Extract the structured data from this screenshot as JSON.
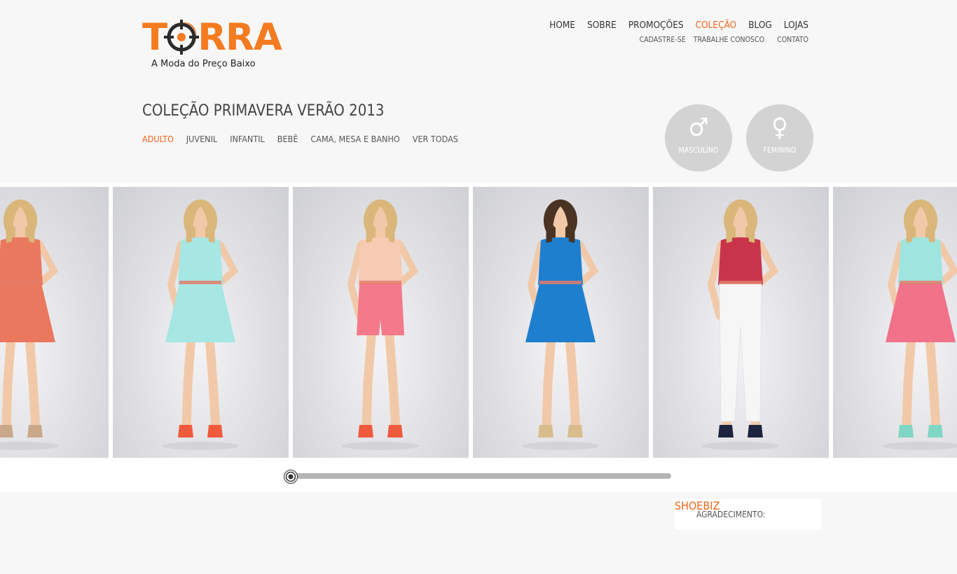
{
  "brand": {
    "logo_text": "TORRA",
    "tagline": "A Moda do Preço Baixo",
    "accent": "#f47b20"
  },
  "main_nav": {
    "items": [
      {
        "label": "HOME"
      },
      {
        "label": "SOBRE"
      },
      {
        "label": "PROMOÇÕES"
      },
      {
        "label": "COLEÇÃO",
        "active": true
      },
      {
        "label": "BLOG"
      },
      {
        "label": "LOJAS"
      }
    ]
  },
  "sub_nav": {
    "items": [
      {
        "label": "CADASTRE-SE"
      },
      {
        "label": "TRABALHE CONOSCO"
      },
      {
        "label": "CONTATO"
      }
    ]
  },
  "collection": {
    "title": "COLEÇÃO PRIMAVERA VERÃO 2013",
    "categories": [
      {
        "label": "ADULTO",
        "active": true
      },
      {
        "label": "JUVENIL"
      },
      {
        "label": "INFANTIL"
      },
      {
        "label": "BEBÊ"
      },
      {
        "label": "CAMA, MESA E BANHO"
      },
      {
        "label": "VER TODAS"
      }
    ]
  },
  "gender": {
    "male": {
      "symbol": "♂",
      "label": "MASCULINO"
    },
    "female": {
      "symbol": "♀",
      "label": "FEMININO"
    }
  },
  "gallery": {
    "photos": [
      {
        "icon": "model-floral-dress-photo",
        "top_color": "#e9785e",
        "bottom_color": "#e9785e",
        "shoe_color": "#c9a88a",
        "hair_color": "#d9b67a"
      },
      {
        "icon": "model-mint-dress-photo",
        "top_color": "#a6e6e3",
        "bottom_color": "#a6e6e3",
        "shoe_color": "#f05a3c",
        "hair_color": "#d9b67a"
      },
      {
        "icon": "model-peach-top-pink-shorts-photo",
        "top_color": "#f7cbb2",
        "bottom_color": "#f4798a",
        "shoe_color": "#f05a3c",
        "hair_color": "#d9b67a"
      },
      {
        "icon": "model-blue-dress-photo",
        "top_color": "#1f7fcf",
        "bottom_color": "#1f7fcf",
        "shoe_color": "#d8bc8c",
        "hair_color": "#4a3322"
      },
      {
        "icon": "model-striped-top-white-jeans-photo",
        "top_color": "#c8354b",
        "bottom_color": "#f6f6f6",
        "shoe_color": "#1d2440",
        "hair_color": "#d9b67a"
      },
      {
        "icon": "model-mint-top-pink-skirt-photo",
        "top_color": "#9ee4df",
        "bottom_color": "#f2728a",
        "shoe_color": "#7fd6c4",
        "hair_color": "#d9b67a"
      }
    ],
    "scroll_position": 0
  },
  "credit": {
    "label": "AGRADECIMENTO:",
    "link": "SHOEBIZ"
  }
}
